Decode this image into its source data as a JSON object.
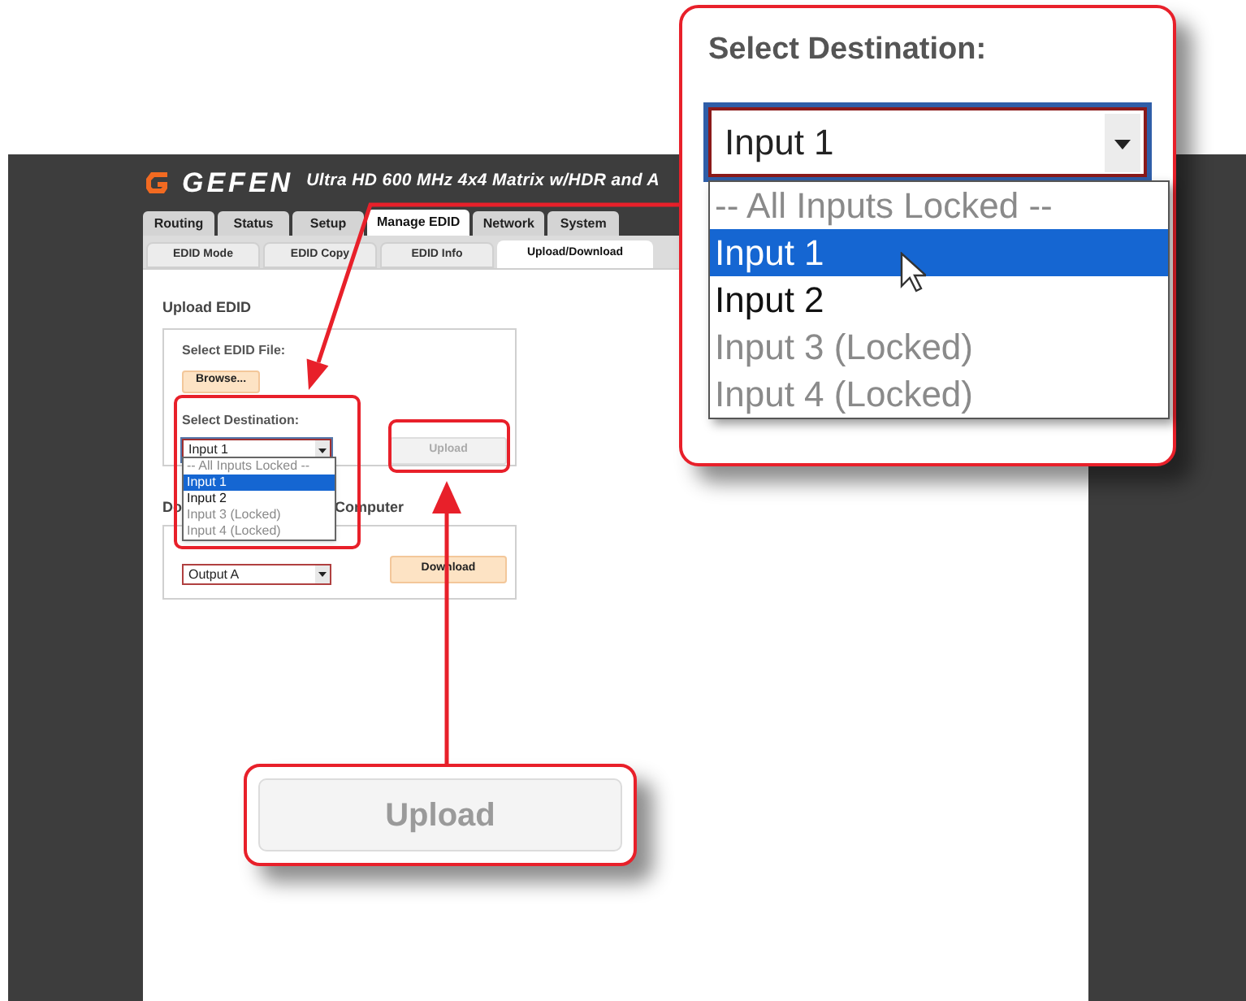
{
  "header": {
    "brand": "GEFEN",
    "title": "Ultra HD 600 MHz 4x4 Matrix w/HDR and A"
  },
  "tabs": [
    {
      "label": "Routing",
      "selected": false
    },
    {
      "label": "Status",
      "selected": false
    },
    {
      "label": "Setup",
      "selected": false
    },
    {
      "label": "Manage EDID",
      "selected": true
    },
    {
      "label": "Network",
      "selected": false
    },
    {
      "label": "System",
      "selected": false
    }
  ],
  "subtabs": [
    {
      "label": "EDID Mode",
      "selected": false
    },
    {
      "label": "EDID Copy",
      "selected": false
    },
    {
      "label": "EDID Info",
      "selected": false
    },
    {
      "label": "Upload/Download",
      "selected": true
    }
  ],
  "upload_section": {
    "heading": "Upload EDID",
    "file_label": "Select EDID File:",
    "browse_button": "Browse...",
    "destination_label": "Select Destination:",
    "destination_value": "Input 1",
    "upload_button": {
      "label": "Upload",
      "disabled": true
    }
  },
  "destination_dropdown": [
    {
      "label": "-- All Inputs Locked --",
      "selected": false,
      "disabled": true
    },
    {
      "label": "Input 1",
      "selected": true,
      "disabled": false
    },
    {
      "label": "Input 2",
      "selected": false,
      "disabled": false
    },
    {
      "label": "Input 3 (Locked)",
      "selected": false,
      "disabled": true
    },
    {
      "label": "Input 4 (Locked)",
      "selected": false,
      "disabled": true
    }
  ],
  "download_section": {
    "heading_start": "Do",
    "heading_end": "Computer",
    "source_value": "Output A",
    "download_button": "Download"
  },
  "zoom_callout": {
    "label": "Select Destination:",
    "value": "Input 1",
    "options": [
      {
        "label": "-- All Inputs Locked --",
        "selected": false,
        "disabled": true
      },
      {
        "label": "Input 1",
        "selected": true,
        "disabled": false
      },
      {
        "label": "Input 2",
        "selected": false,
        "disabled": false
      },
      {
        "label": "Input 3 (Locked)",
        "selected": false,
        "disabled": true
      },
      {
        "label": "Input 4 (Locked)",
        "selected": false,
        "disabled": true
      }
    ]
  },
  "button_callout": {
    "label": "Upload",
    "disabled": true
  }
}
